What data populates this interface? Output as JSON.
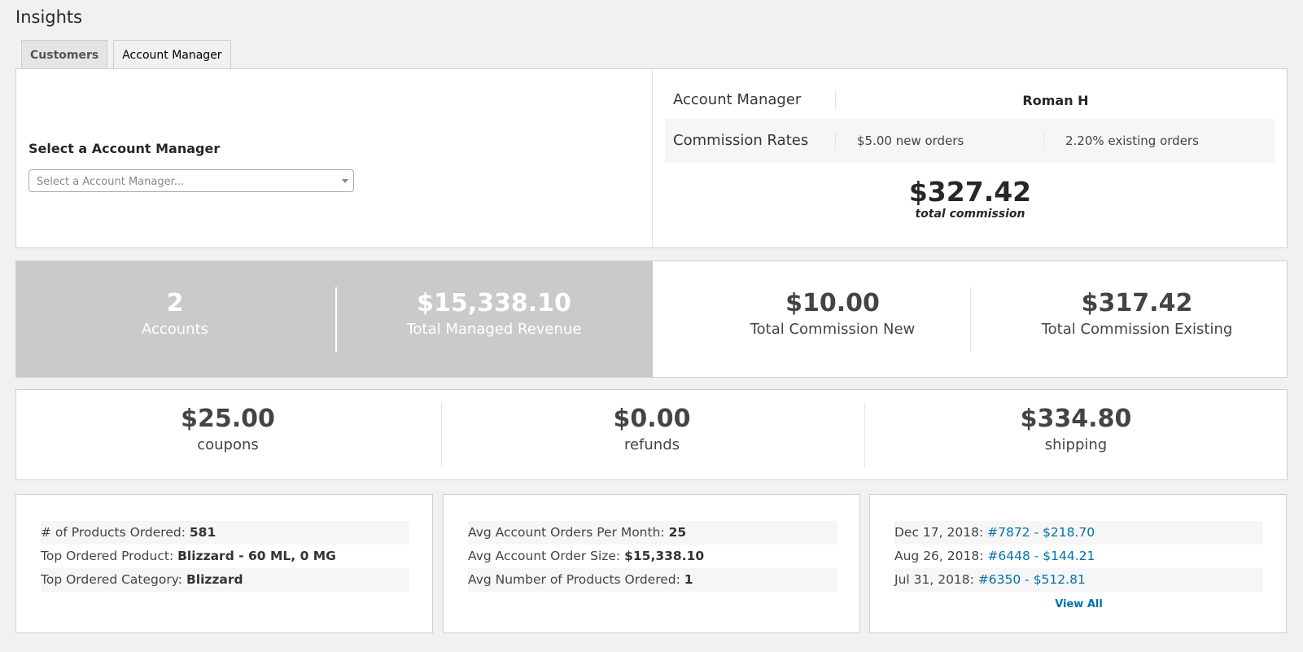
{
  "page": {
    "title": "Insights"
  },
  "tabs": [
    {
      "label": "Customers",
      "active": false
    },
    {
      "label": "Account Manager",
      "active": true
    }
  ],
  "selector": {
    "heading": "Select a Account Manager",
    "placeholder": "Select a Account Manager..."
  },
  "manager_info": {
    "manager_label": "Account Manager",
    "manager_name": "Roman H",
    "rates_label": "Commission Rates",
    "rate_new": "$5.00 new orders",
    "rate_existing": "2.20% existing orders",
    "total_commission": "$327.42",
    "total_commission_caption": "total commission"
  },
  "stats": [
    {
      "value": "2",
      "label": "Accounts"
    },
    {
      "value": "$15,338.10",
      "label": "Total Managed Revenue"
    },
    {
      "value": "$10.00",
      "label": "Total Commission New"
    },
    {
      "value": "$317.42",
      "label": "Total Commission Existing"
    }
  ],
  "totals": [
    {
      "value": "$25.00",
      "label": "coupons"
    },
    {
      "value": "$0.00",
      "label": "refunds"
    },
    {
      "value": "$334.80",
      "label": "shipping"
    }
  ],
  "products": [
    {
      "label": "# of Products Ordered:",
      "value": "581"
    },
    {
      "label": "Top Ordered Product:",
      "value": "Blizzard - 60 ML, 0 MG"
    },
    {
      "label": "Top Ordered Category:",
      "value": "Blizzard"
    }
  ],
  "averages": [
    {
      "label": "Avg Account Orders Per Month:",
      "value": "25"
    },
    {
      "label": "Avg Account Order Size:",
      "value": "$15,338.10"
    },
    {
      "label": "Avg Number of Products Ordered:",
      "value": "1"
    }
  ],
  "recent_orders": [
    {
      "date": "Dec 17, 2018:",
      "link": "#7872 - $218.70"
    },
    {
      "date": "Aug 26, 2018:",
      "link": "#6448 - $144.21"
    },
    {
      "date": "Jul 31, 2018:",
      "link": "#6350 - $512.81"
    }
  ],
  "view_all_label": "View All",
  "colors": {
    "link": "#0073aa",
    "stats_grey": "#cacaca",
    "background": "#f1f1f1"
  }
}
